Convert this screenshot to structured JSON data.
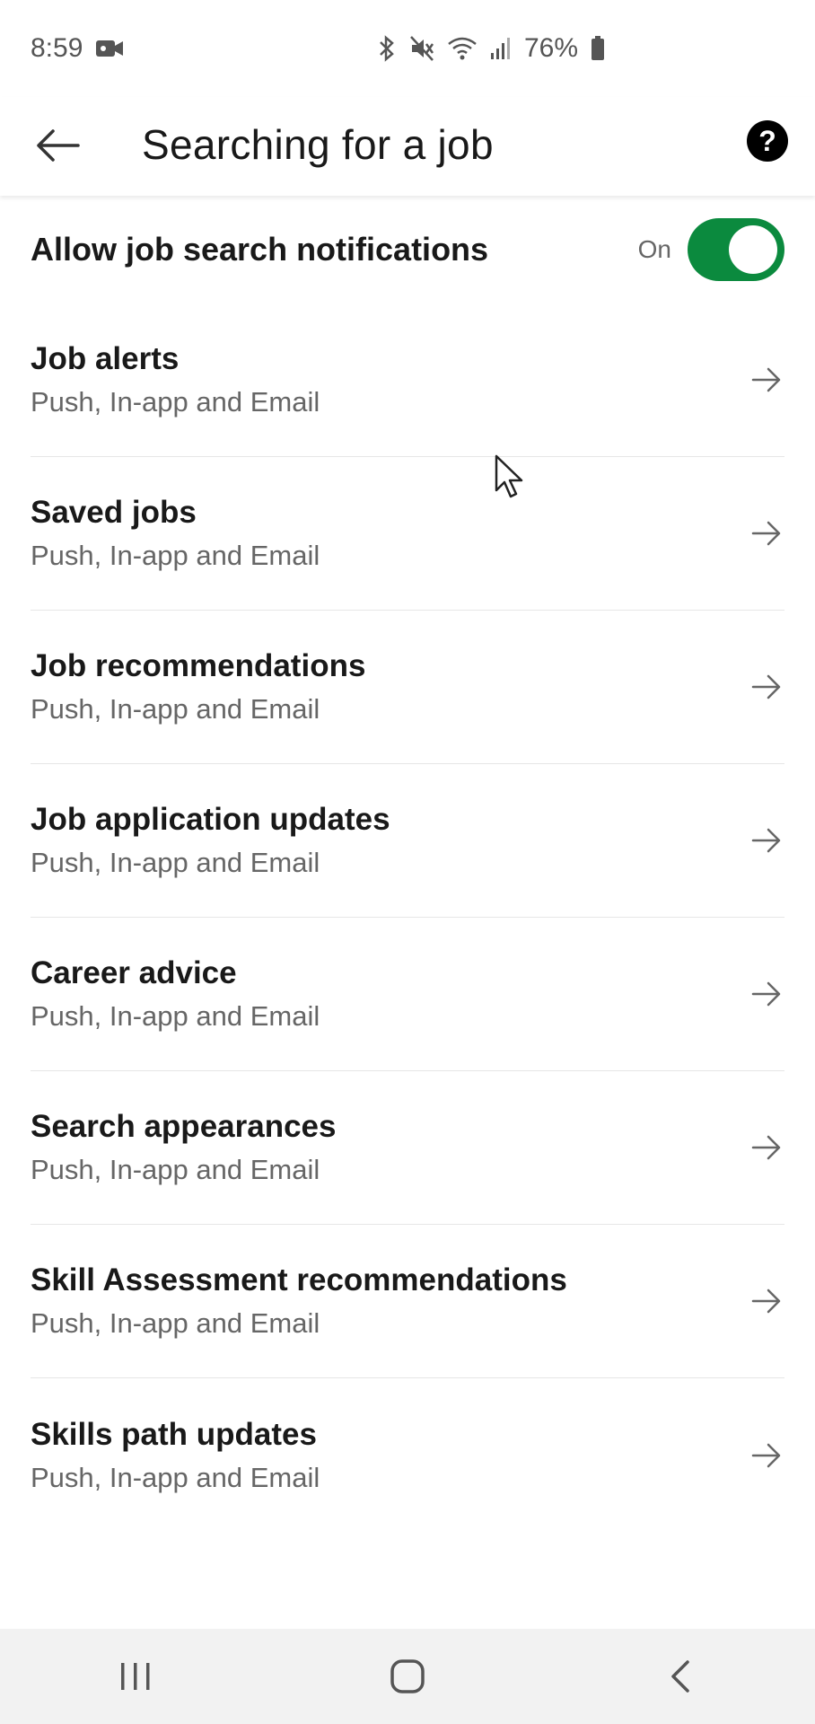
{
  "status_bar": {
    "time": "8:59",
    "battery": "76%",
    "icons": [
      "video-camera-icon",
      "bluetooth-icon",
      "mute-icon",
      "wifi-icon",
      "signal-icon",
      "battery-icon"
    ]
  },
  "header": {
    "title": "Searching for a job",
    "back_icon": "back-arrow-icon",
    "help_label": "?"
  },
  "master": {
    "label": "Allow job search notifications",
    "state_label": "On",
    "enabled": true,
    "accent_color": "#0b8a3e"
  },
  "items": [
    {
      "title": "Job alerts",
      "subtitle": "Push, In-app and Email"
    },
    {
      "title": "Saved jobs",
      "subtitle": "Push, In-app and Email"
    },
    {
      "title": "Job recommendations",
      "subtitle": "Push, In-app and Email"
    },
    {
      "title": "Job application updates",
      "subtitle": "Push, In-app and Email"
    },
    {
      "title": "Career advice",
      "subtitle": "Push, In-app and Email"
    },
    {
      "title": "Search appearances",
      "subtitle": "Push, In-app and Email"
    },
    {
      "title": "Skill Assessment recommendations",
      "subtitle": "Push, In-app and Email"
    },
    {
      "title": "Skills path updates",
      "subtitle": "Push, In-app and Email"
    }
  ],
  "nav_bar": {
    "buttons": [
      "recent-apps-icon",
      "home-icon",
      "back-icon"
    ]
  }
}
